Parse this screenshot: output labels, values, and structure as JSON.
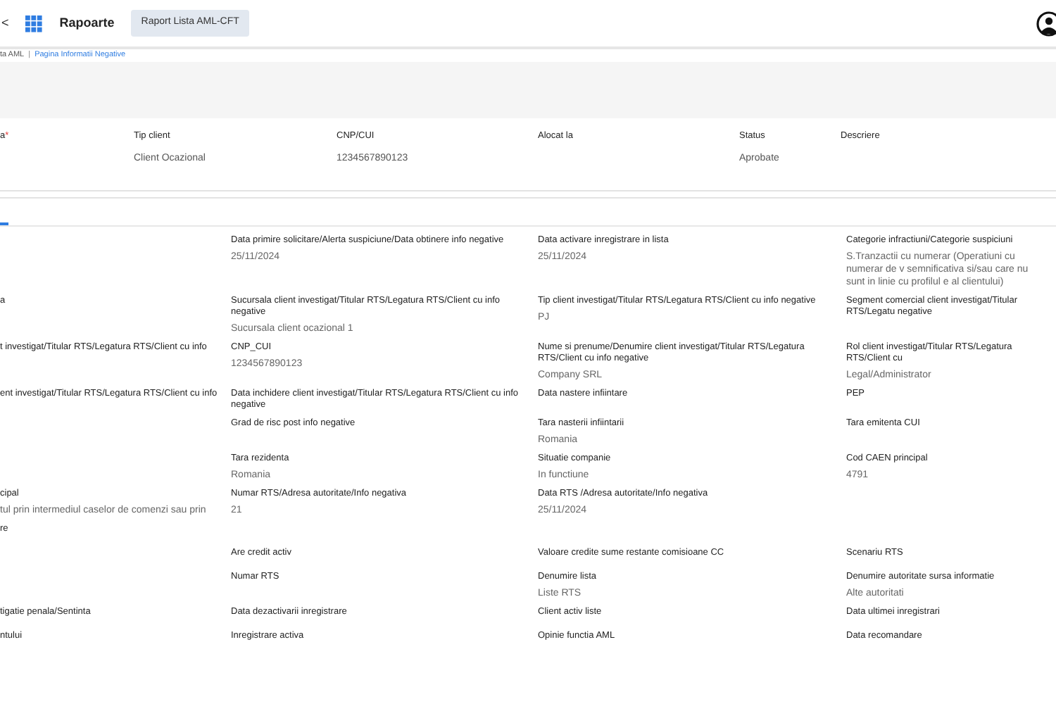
{
  "header": {
    "back_glyph": "<",
    "title": "Rapoarte",
    "tabs": [
      {
        "label": "Raport Lista AML-CFT",
        "selected": true
      }
    ]
  },
  "breadcrumb": {
    "separator": "|",
    "items": [
      {
        "label": "ta AML",
        "link": false
      },
      {
        "label": "Pagina Informatii Negative",
        "link": true
      }
    ]
  },
  "summary": [
    {
      "label": "a",
      "required_mark": "*"
    },
    {
      "label": "Tip client",
      "value": "Client Ocazional"
    },
    {
      "label": "CNP/CUI",
      "value": "1234567890123"
    },
    {
      "label": "Alocat la"
    },
    {
      "label": "Status",
      "value": "Aprobate"
    },
    {
      "label": "Descriere"
    }
  ],
  "detail_rows": [
    [
      null,
      {
        "label": "Data primire solicitare/Alerta suspiciune/Data obtinere info negative",
        "value": "25/11/2024"
      },
      {
        "label": "Data activare inregistrare in lista",
        "value": "25/11/2024"
      },
      {
        "label": "Categorie infractiuni/Categorie suspiciuni",
        "value": "S.Tranzactii cu numerar (Operatiuni cu numerar de v semnificativa si/sau care nu sunt in linie cu profilul e al clientului)"
      }
    ],
    [
      {
        "label": "a"
      },
      {
        "label": "Sucursala client investigat/Titular RTS/Legatura RTS/Client cu info negative",
        "value": "Sucursala client ocazional 1"
      },
      {
        "label": "Tip client investigat/Titular RTS/Legatura RTS/Client cu info negative",
        "value": "PJ"
      },
      {
        "label": "Segment comercial client investigat/Titular RTS/Legatu negative"
      }
    ],
    [
      {
        "label": "t investigat/Titular RTS/Legatura RTS/Client cu info"
      },
      {
        "label": "CNP_CUI",
        "value": "1234567890123"
      },
      {
        "label": "Nume si prenume/Denumire client investigat/Titular RTS/Legatura RTS/Client cu info negative",
        "value": "Company SRL"
      },
      {
        "label": "Rol client investigat/Titular RTS/Legatura RTS/Client cu",
        "value": "Legal/Administrator"
      }
    ],
    [
      {
        "label": "ent investigat/Titular RTS/Legatura RTS/Client cu info"
      },
      {
        "label": "Data inchidere client investigat/Titular RTS/Legatura RTS/Client cu info negative"
      },
      {
        "label": "Data nastere infiintare"
      },
      {
        "label": "PEP"
      }
    ],
    [
      null,
      {
        "label": "Grad de risc post info negative"
      },
      {
        "label": "Tara nasterii infiintarii",
        "value": "Romania"
      },
      {
        "label": "Tara emitenta CUI"
      }
    ],
    [
      null,
      {
        "label": "Tara rezidenta",
        "value": "Romania"
      },
      {
        "label": "Situatie companie",
        "value": "In functiune"
      },
      {
        "label": "Cod CAEN principal",
        "value": "4791"
      }
    ],
    [
      {
        "label": "cipal",
        "value": "tul prin intermediul caselor de comenzi sau prin"
      },
      {
        "label": "Numar RTS/Adresa autoritate/Info negativa",
        "value": "21"
      },
      {
        "label": "Data RTS /Adresa autoritate/Info negativa",
        "value": "25/11/2024"
      },
      null
    ],
    [
      {
        "label": "re"
      },
      null,
      null,
      null
    ],
    [
      null,
      {
        "label": "Are credit activ"
      },
      {
        "label": "Valoare credite sume restante comisioane CC"
      },
      {
        "label": "Scenariu RTS"
      }
    ],
    [
      null,
      {
        "label": "Numar RTS"
      },
      {
        "label": "Denumire lista",
        "value": "Liste RTS"
      },
      {
        "label": "Denumire autoritate sursa informatie",
        "value": "Alte autoritati"
      }
    ],
    [
      {
        "label": "tigatie penala/Sentinta"
      },
      {
        "label": "Data dezactivarii inregistrare"
      },
      {
        "label": "Client activ liste"
      },
      {
        "label": "Data ultimei inregistrari"
      }
    ],
    [
      {
        "label": "ntului"
      },
      {
        "label": "Inregistrare activa"
      },
      {
        "label": "Opinie functia AML"
      },
      {
        "label": "Data recomandare"
      }
    ]
  ]
}
